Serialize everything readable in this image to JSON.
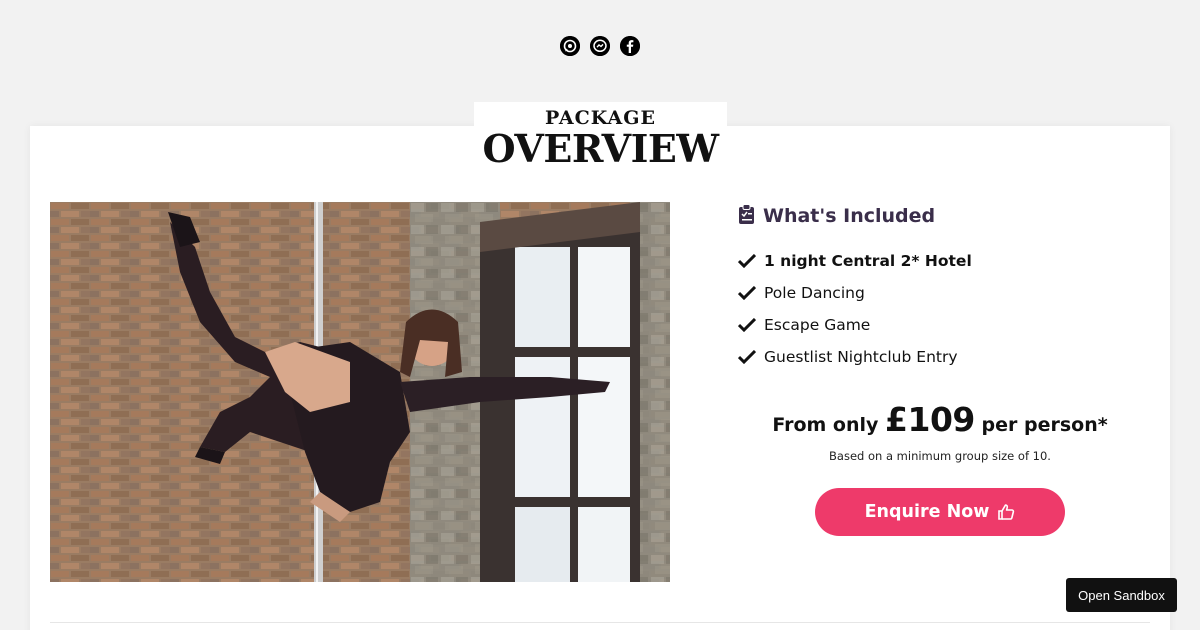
{
  "social": [
    {
      "icon": "whatsapp-icon"
    },
    {
      "icon": "messenger-icon"
    },
    {
      "icon": "facebook-icon"
    }
  ],
  "section": {
    "title_top": "PACKAGE",
    "title_main": "OVERVIEW"
  },
  "included": {
    "heading": "What's Included",
    "icon": "clipboard-icon",
    "items": [
      {
        "label": "1 night Central 2* Hotel",
        "bold": true
      },
      {
        "label": "Pole Dancing",
        "bold": false
      },
      {
        "label": "Escape Game",
        "bold": false
      },
      {
        "label": "Guestlist Nightclub Entry",
        "bold": false
      }
    ]
  },
  "pricing": {
    "prefix": "From only",
    "amount": "£109",
    "suffix": "per person*",
    "note": "Based on a minimum group size of 10."
  },
  "cta": {
    "label": "Enquire Now",
    "icon": "thumbs-up-icon",
    "color": "#ee3a6a"
  },
  "sandbox": {
    "label": "Open Sandbox"
  }
}
